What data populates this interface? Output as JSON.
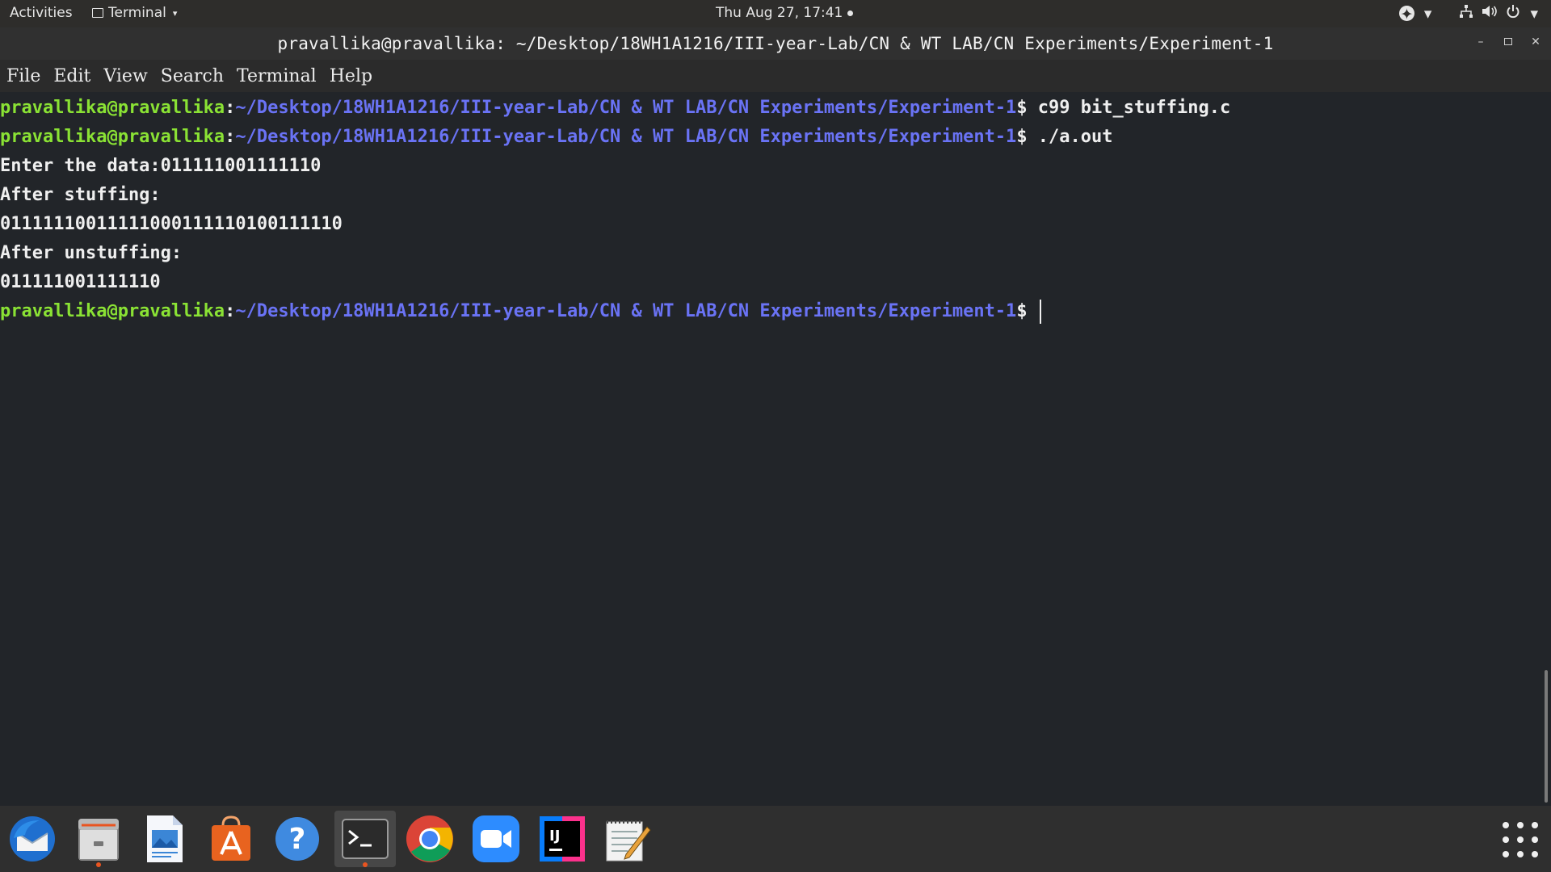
{
  "topbar": {
    "activities": "Activities",
    "app_menu": "Terminal",
    "clock": "Thu Aug 27, 17:41"
  },
  "window": {
    "title": "pravallika@pravallika: ~/Desktop/18WH1A1216/III-year-Lab/CN & WT LAB/CN Experiments/Experiment-1"
  },
  "menubar": {
    "items": [
      "File",
      "Edit",
      "View",
      "Search",
      "Terminal",
      "Help"
    ]
  },
  "terminal": {
    "user_host": "pravallika@pravallika",
    "colon": ":",
    "path": "~/Desktop/18WH1A1216/III-year-Lab/CN & WT LAB/CN Experiments/Experiment-1",
    "dollar": "$",
    "cmd1": " c99 bit_stuffing.c",
    "cmd2": " ./a.out",
    "cmd3": " ",
    "out1": "Enter the data:011111001111110",
    "out2": "After stuffing:",
    "out3": "01111110011111000111110100111110",
    "out4": "After unstuffing:",
    "out5": "011111001111110"
  },
  "dock": {
    "apps": [
      "thunderbird-icon",
      "files-icon",
      "writer-icon",
      "software-center-icon",
      "help-icon",
      "terminal-icon",
      "chrome-icon",
      "zoom-icon",
      "intellij-icon",
      "text-editor-icon"
    ]
  },
  "colors": {
    "prompt_user": "#8ae234",
    "prompt_path": "#6a73f5",
    "background": "#222529",
    "accent": "#e95420"
  }
}
